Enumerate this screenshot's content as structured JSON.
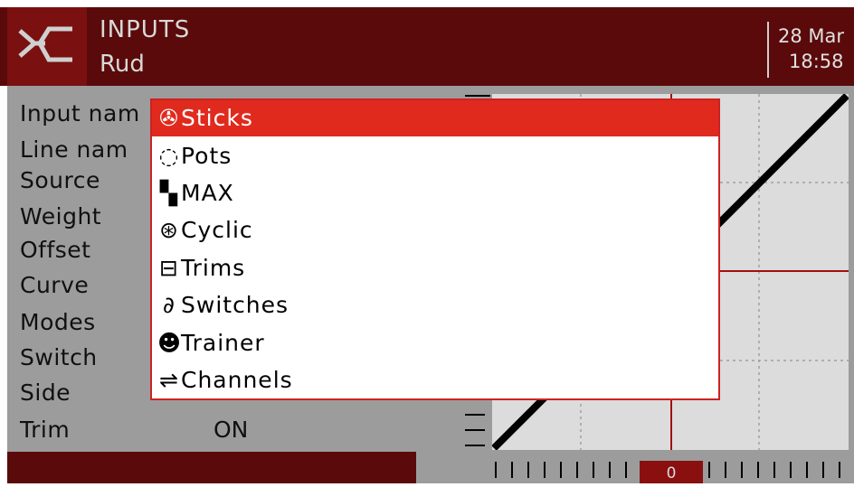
{
  "header": {
    "title": "INPUTS",
    "subtitle": "Rud",
    "date": "28 Mar",
    "time": "18:58"
  },
  "fields": [
    {
      "label": "Input nam"
    },
    {
      "label": "Line nam"
    },
    {
      "label": "Source"
    },
    {
      "label": "Weight"
    },
    {
      "label": "Offset"
    },
    {
      "label": "Curve"
    },
    {
      "label": "Modes"
    },
    {
      "label": "Switch"
    },
    {
      "label": "Side"
    },
    {
      "label": "Trim",
      "value": "ON"
    }
  ],
  "graph": {
    "zero_label": "0"
  },
  "menu": {
    "items": [
      {
        "icon": "sticks-icon",
        "glyph": "✇",
        "label": "Sticks",
        "selected": true
      },
      {
        "icon": "pots-icon",
        "glyph": "◌",
        "label": "Pots",
        "selected": false
      },
      {
        "icon": "max-icon",
        "glyph": "▚",
        "label": "MAX",
        "selected": false
      },
      {
        "icon": "cyclic-icon",
        "glyph": "⊛",
        "label": "Cyclic",
        "selected": false
      },
      {
        "icon": "trims-icon",
        "glyph": "⊟",
        "label": "Trims",
        "selected": false
      },
      {
        "icon": "switches-icon",
        "glyph": "∂",
        "label": "Switches",
        "selected": false
      },
      {
        "icon": "trainer-icon",
        "glyph": "☻",
        "label": "Trainer",
        "selected": false
      },
      {
        "icon": "channels-icon",
        "glyph": "⇌",
        "label": "Channels",
        "selected": false
      }
    ]
  },
  "colors": {
    "header": "#5a0a0a",
    "accent": "#e02a1e",
    "background": "#9c9c9c"
  }
}
